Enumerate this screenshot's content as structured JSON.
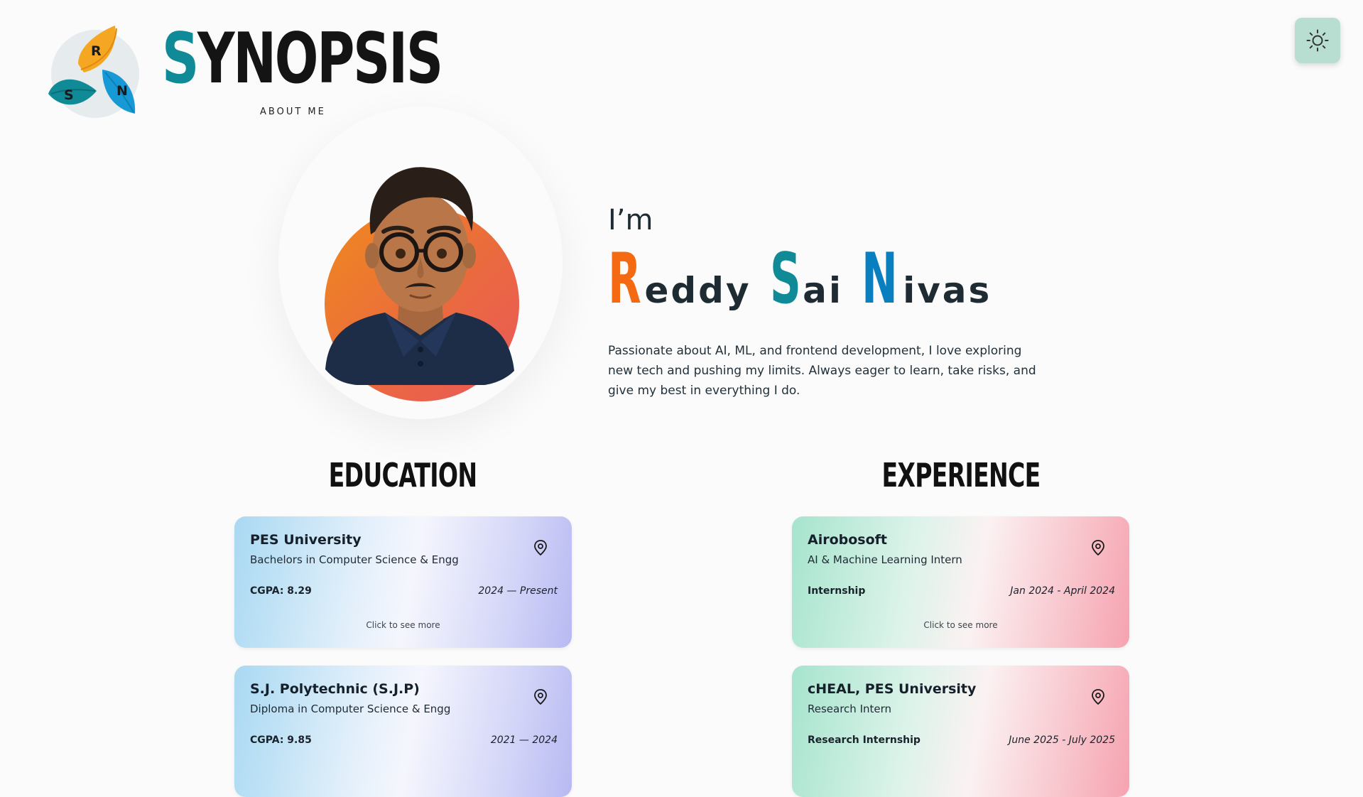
{
  "brand": {
    "logo_letters": [
      "R",
      "S",
      "N"
    ],
    "title_first": "S",
    "title_rest": "YNOPSIS",
    "subtitle": "ABOUT ME"
  },
  "theme_toggle": {
    "icon": "sun-icon"
  },
  "intro": {
    "greeting": "I’m",
    "name_parts": [
      {
        "initial": "R",
        "rest": "eddy",
        "color": "#f46a12"
      },
      {
        "initial": "S",
        "rest": "ai",
        "color": "#0f8a96"
      },
      {
        "initial": "N",
        "rest": "ivas",
        "color": "#0a7fc0"
      }
    ],
    "bio": "Passionate about AI, ML, and frontend development, I love exploring new tech and pushing my limits. Always eager to learn, take risks, and give my best in everything I do."
  },
  "education": {
    "heading": "EDUCATION",
    "items": [
      {
        "title": "PES University",
        "subtitle": "Bachelors in Computer Science & Engg",
        "meta": "CGPA: 8.29",
        "dates": "2024 — Present",
        "more": "Click to see more"
      },
      {
        "title": "S.J. Polytechnic (S.J.P)",
        "subtitle": "Diploma in Computer Science & Engg",
        "meta": "CGPA: 9.85",
        "dates": "2021 — 2024",
        "more": ""
      }
    ]
  },
  "experience": {
    "heading": "EXPERIENCE",
    "items": [
      {
        "title": "Airobosoft",
        "subtitle": "AI & Machine Learning Intern",
        "meta": "Internship",
        "dates": "Jan 2024 - April 2024",
        "more": "Click to see more"
      },
      {
        "title": "cHEAL, PES University",
        "subtitle": "Research Intern",
        "meta": "Research Internship",
        "dates": "June 2025 - July 2025",
        "more": ""
      }
    ]
  },
  "colors": {
    "accent_teal": "#0f8a96",
    "accent_orange": "#f46a12",
    "accent_blue": "#0a7fc0",
    "theme_button_bg": "#b8ddd1"
  }
}
